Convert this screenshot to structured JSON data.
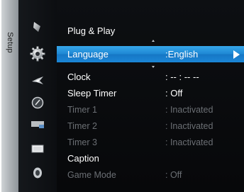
{
  "sidebar": {
    "section_label": "Setup",
    "icons": [
      {
        "name": "picture-icon"
      },
      {
        "name": "setup-gear-icon",
        "active": true
      },
      {
        "name": "channel-icon"
      },
      {
        "name": "input-icon"
      },
      {
        "name": "application-icon"
      },
      {
        "name": "support-icon"
      },
      {
        "name": "sound-icon"
      }
    ]
  },
  "menu": {
    "items": [
      {
        "label": "Plug & Play",
        "value": "",
        "state": "normal"
      },
      {
        "label": "Language",
        "value": ":English",
        "state": "selected"
      },
      {
        "label": "Clock",
        "value": ": -- : -- --",
        "state": "normal"
      },
      {
        "label": "Sleep Timer",
        "value": ": Off",
        "state": "normal"
      },
      {
        "label": "Timer 1",
        "value": ": Inactivated",
        "state": "disabled"
      },
      {
        "label": "Timer 2",
        "value": ": Inactivated",
        "state": "disabled"
      },
      {
        "label": "Timer 3",
        "value": ": Inactivated",
        "state": "disabled"
      },
      {
        "label": "Caption",
        "value": "",
        "state": "normal"
      },
      {
        "label": "Game Mode",
        "value": ": Off",
        "state": "disabled"
      }
    ]
  },
  "colors": {
    "highlight": "#1f88d4",
    "background": "#0a0c0e",
    "disabled_text": "#6b6f74",
    "text": "#ffffff"
  }
}
